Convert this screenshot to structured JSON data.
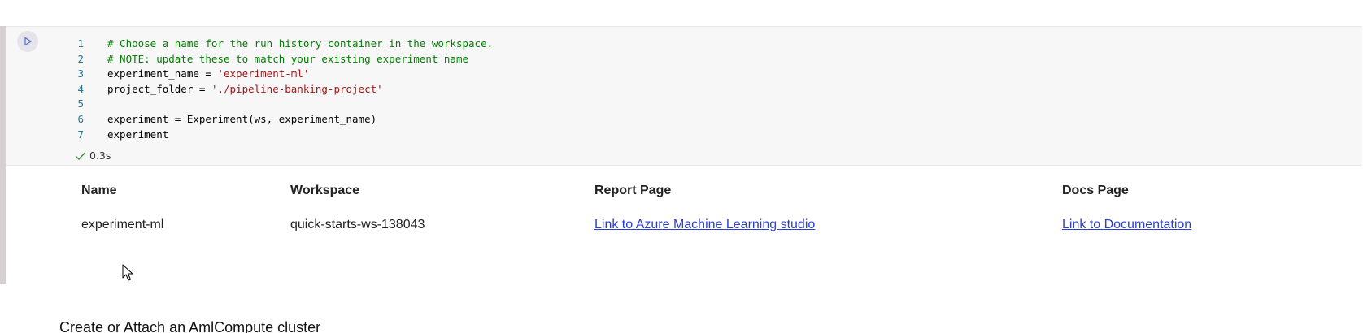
{
  "cell": {
    "code_lines": [
      {
        "num": "1",
        "tokens": [
          {
            "t": "comment",
            "v": "# Choose a name for the run history container in the workspace."
          }
        ]
      },
      {
        "num": "2",
        "tokens": [
          {
            "t": "comment",
            "v": "# NOTE: update these to match your existing experiment name"
          }
        ]
      },
      {
        "num": "3",
        "tokens": [
          {
            "t": "plain",
            "v": "experiment_name = "
          },
          {
            "t": "string",
            "v": "'experiment-ml'"
          }
        ]
      },
      {
        "num": "4",
        "tokens": [
          {
            "t": "plain",
            "v": "project_folder = "
          },
          {
            "t": "string",
            "v": "'./pipeline-banking-project'"
          }
        ]
      },
      {
        "num": "5",
        "tokens": []
      },
      {
        "num": "6",
        "tokens": [
          {
            "t": "plain",
            "v": "experiment = Experiment(ws, experiment_name)"
          }
        ]
      },
      {
        "num": "7",
        "tokens": [
          {
            "t": "plain",
            "v": "experiment"
          }
        ]
      }
    ],
    "exec_time": "0.3s"
  },
  "output_table": {
    "headers": [
      "Name",
      "Workspace",
      "Report Page",
      "Docs Page"
    ],
    "row": {
      "name": "experiment-ml",
      "workspace": "quick-starts-ws-138043",
      "report_link": "Link to Azure Machine Learning studio",
      "docs_link": "Link to Documentation"
    }
  },
  "next_section": {
    "title": "Create or Attach an AmlCompute cluster"
  },
  "colors": {
    "comment": "#008000",
    "string": "#a31515",
    "line_number": "#237893",
    "link": "#2a3fd8",
    "success": "#388a34"
  }
}
